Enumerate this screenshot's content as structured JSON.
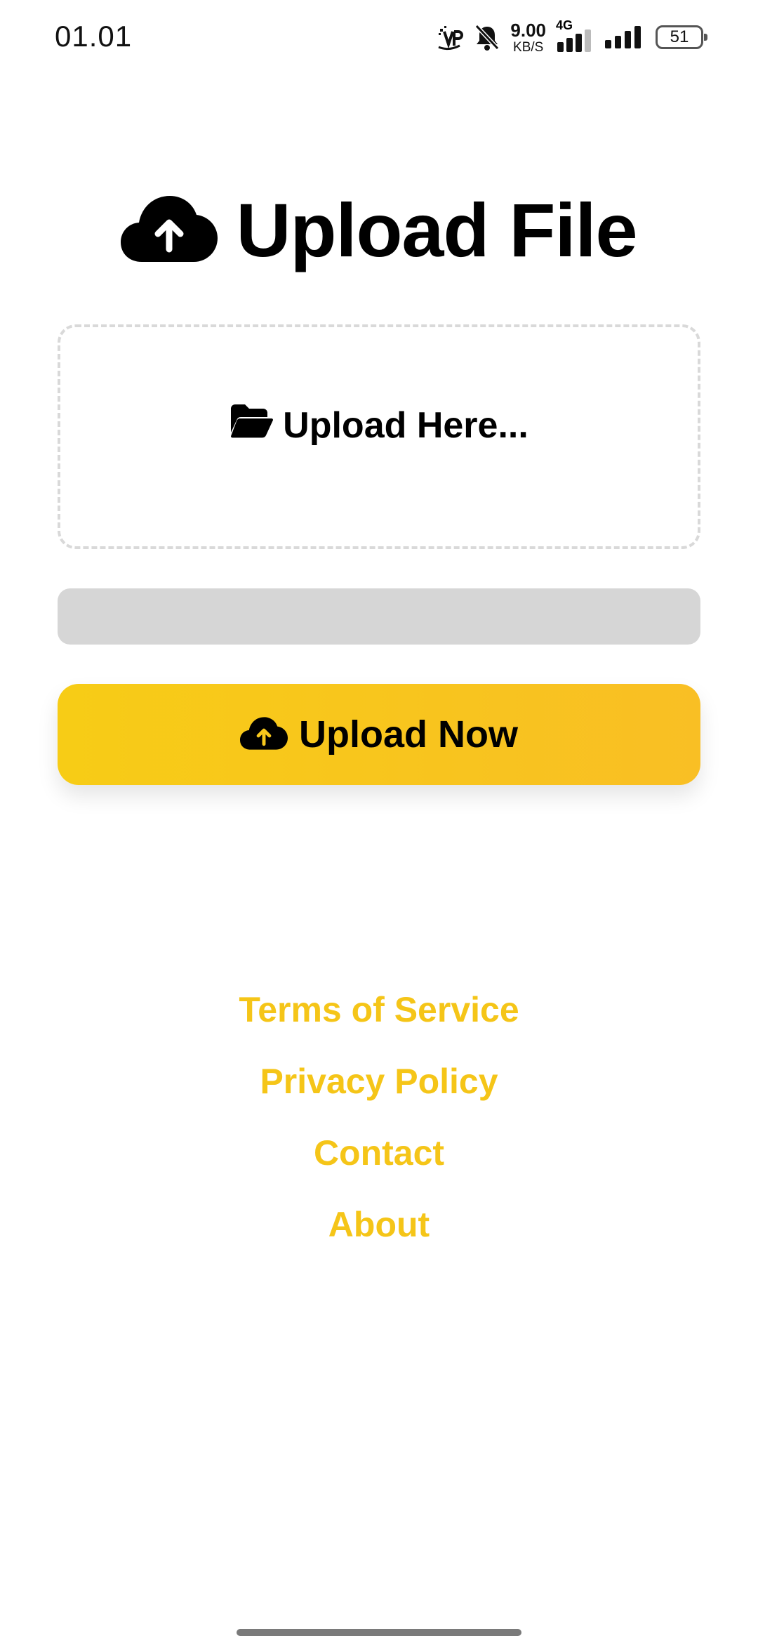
{
  "status_bar": {
    "time": "01.01",
    "net_speed_value": "9.00",
    "net_speed_unit": "KB/S",
    "network_type": "4G",
    "battery": "51",
    "icons": [
      "vpn-key-icon",
      "bell-muted-icon",
      "signal-4g-icon",
      "signal-bars-icon",
      "battery-icon"
    ]
  },
  "header": {
    "title": "Upload File",
    "icon": "cloud-upload-icon"
  },
  "drop_zone": {
    "label": "Upload Here...",
    "icon": "folder-open-icon"
  },
  "progress": {
    "value": 0
  },
  "upload_button": {
    "label": "Upload Now",
    "icon": "cloud-upload-icon"
  },
  "footer": {
    "links": [
      "Terms of Service",
      "Privacy Policy",
      "Contact",
      "About"
    ]
  },
  "colors": {
    "accent": "#f5c518",
    "button_gradient_start": "#f7cc16",
    "button_gradient_end": "#f9bf24",
    "progress_track": "#d6d6d6",
    "drop_zone_border": "#d9d9d9"
  }
}
